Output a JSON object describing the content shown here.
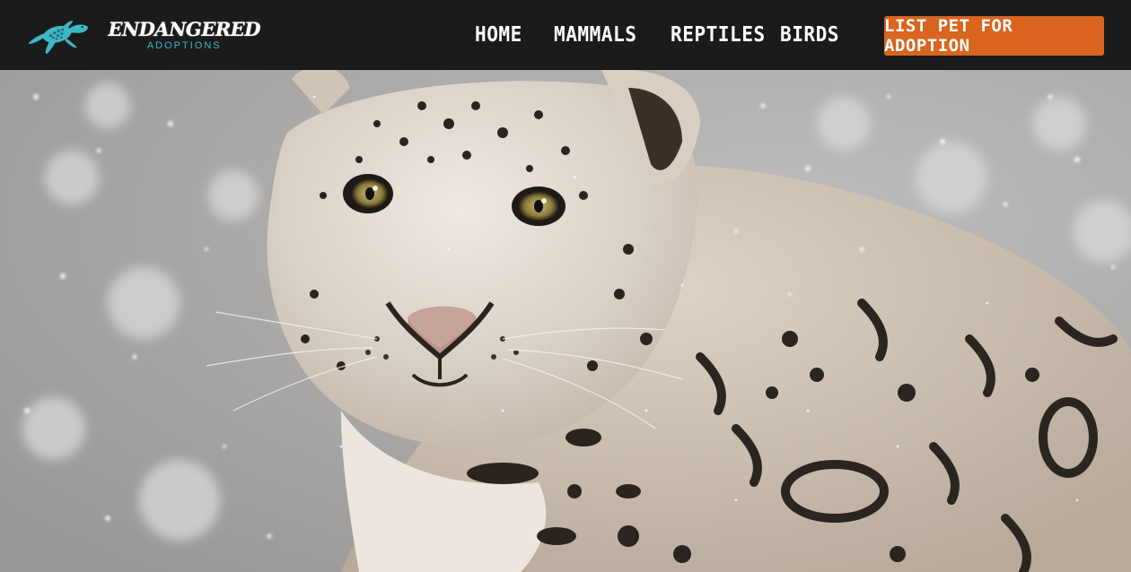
{
  "brand": {
    "title": "ENDANGERED",
    "subtitle": "ADOPTIONS",
    "logo_icon": "sea-turtle-icon",
    "accent_color": "#3db8c4"
  },
  "nav": {
    "items": [
      {
        "label": "HOME"
      },
      {
        "label": "MAMMALS"
      },
      {
        "label": "REPTILES"
      },
      {
        "label": "BIRDS"
      }
    ]
  },
  "cta": {
    "label": "LIST PET FOR ADOPTION",
    "color": "#d9651f"
  },
  "colors": {
    "navbar_bg": "#1b1b1b"
  }
}
